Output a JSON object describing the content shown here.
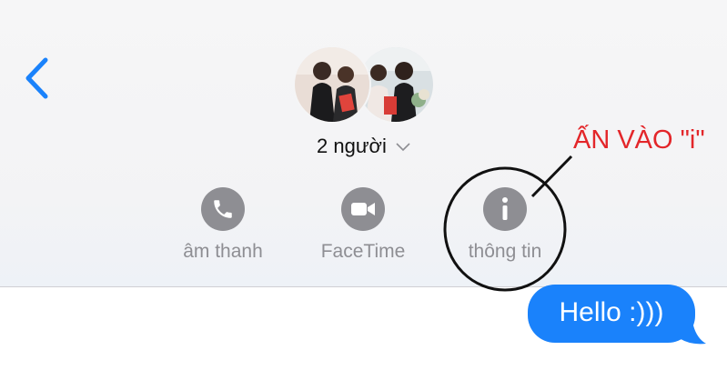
{
  "header": {
    "group_name": "2 người"
  },
  "actions": [
    {
      "label": "âm thanh",
      "icon": "phone-icon"
    },
    {
      "label": "FaceTime",
      "icon": "video-camera-icon"
    },
    {
      "label": "thông tin",
      "icon": "info-icon"
    }
  ],
  "annotation": {
    "text": "ẤN VÀO \"i\"",
    "color": "#e3262a"
  },
  "messages": [
    {
      "text": "Hello :)))",
      "direction": "outgoing"
    }
  ],
  "colors": {
    "accent": "#1a82fb",
    "icon_gray": "#8e8e93"
  }
}
